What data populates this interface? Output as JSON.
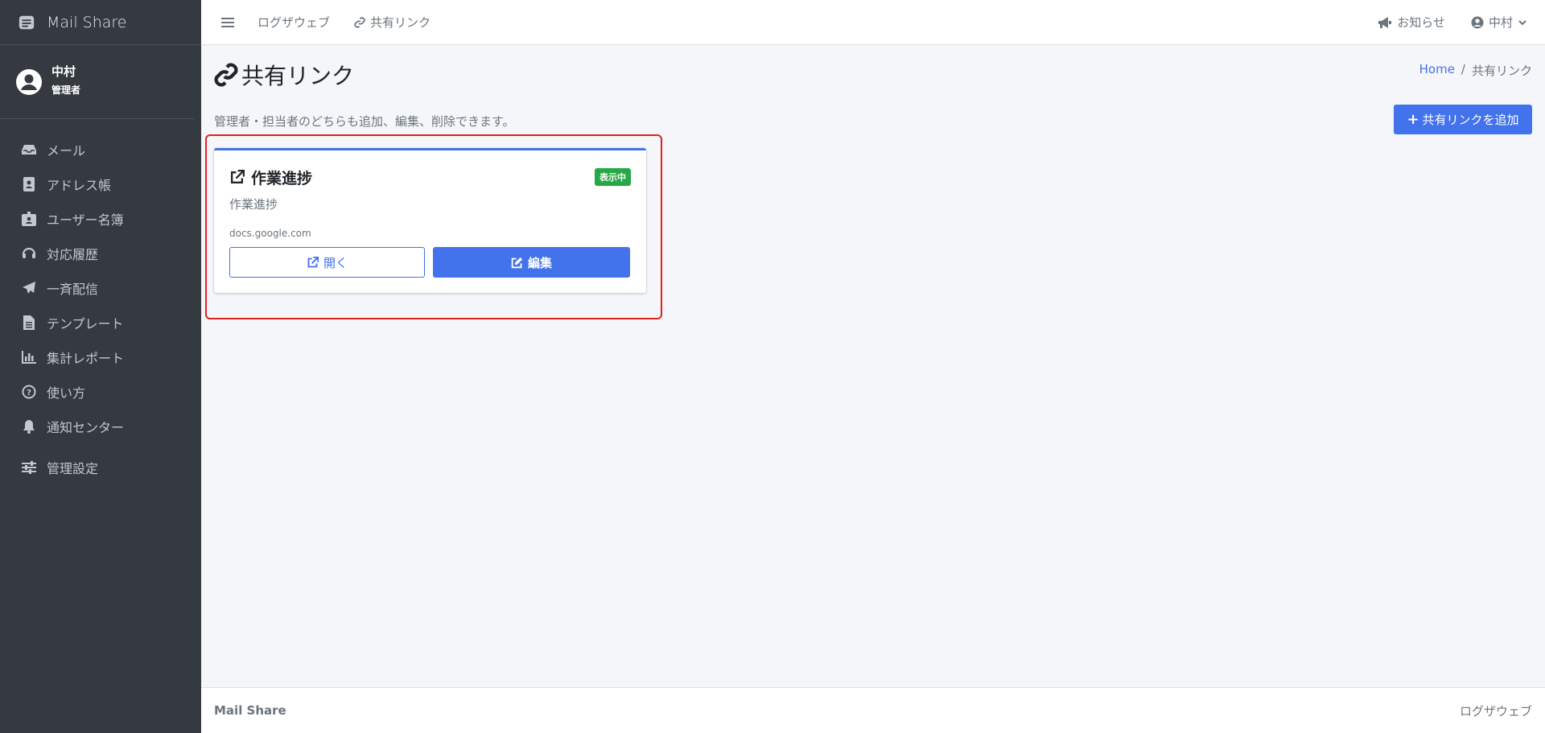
{
  "app": {
    "brand": "Mail Share"
  },
  "user_panel": {
    "name": "中村",
    "role": "管理者"
  },
  "sidebar": {
    "items": [
      {
        "label": "メール",
        "icon": "inbox-icon"
      },
      {
        "label": "アドレス帳",
        "icon": "address-book-icon"
      },
      {
        "label": "ユーザー名簿",
        "icon": "id-badge-icon"
      },
      {
        "label": "対応履歴",
        "icon": "headset-icon"
      },
      {
        "label": "一斉配信",
        "icon": "paper-plane-icon"
      },
      {
        "label": "テンプレート",
        "icon": "file-icon"
      },
      {
        "label": "集計レポート",
        "icon": "bar-chart-icon"
      },
      {
        "label": "使い方",
        "icon": "question-circle-icon"
      },
      {
        "label": "通知センター",
        "icon": "bell-icon"
      },
      {
        "label": "管理設定",
        "icon": "sliders-icon"
      }
    ]
  },
  "topbar": {
    "links": [
      {
        "label": "ログザウェブ"
      },
      {
        "label": "共有リンク",
        "icon": "link-icon"
      }
    ],
    "notice": "お知らせ",
    "user": "中村"
  },
  "page": {
    "title": "共有リンク",
    "breadcrumb": {
      "home": "Home",
      "separator": "/",
      "current": "共有リンク"
    },
    "description": "管理者・担当者のどちらも追加、編集、削除できます。",
    "add_button": "共有リンクを追加"
  },
  "cards": [
    {
      "title": "作業進捗",
      "badge": "表示中",
      "subtitle": "作業進捗",
      "domain": "docs.google.com",
      "open_label": "開く",
      "edit_label": "編集"
    }
  ],
  "footer": {
    "brand": "Mail Share",
    "right": "ログザウェブ"
  },
  "colors": {
    "sidebar_bg": "#343a40",
    "primary": "#4272ec",
    "badge_green": "#28a745",
    "highlight_red": "#e02020"
  }
}
